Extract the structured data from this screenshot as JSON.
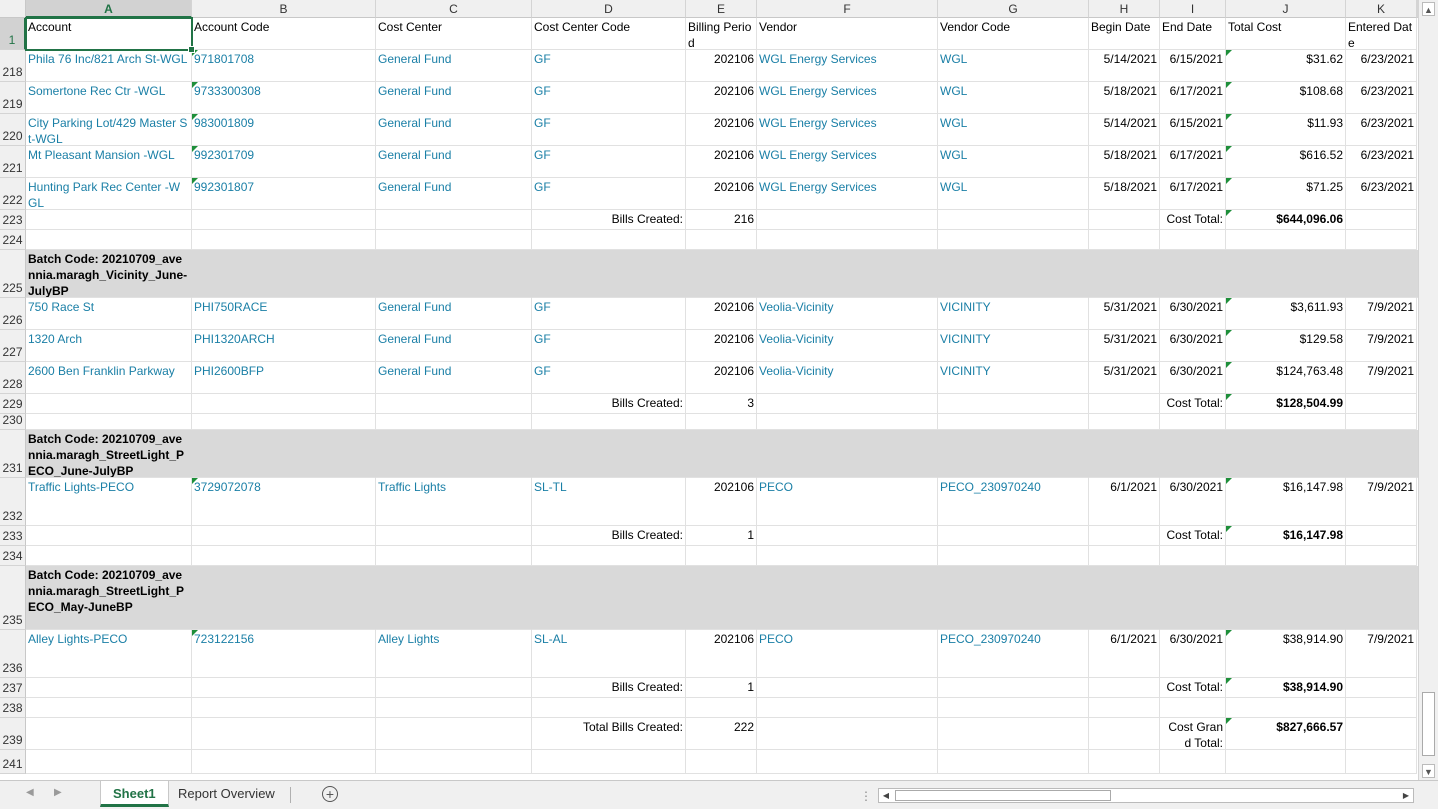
{
  "columns": [
    {
      "letter": "A",
      "w": 166,
      "selected": true
    },
    {
      "letter": "B",
      "w": 184
    },
    {
      "letter": "C",
      "w": 156
    },
    {
      "letter": "D",
      "w": 154
    },
    {
      "letter": "E",
      "w": 71
    },
    {
      "letter": "F",
      "w": 181
    },
    {
      "letter": "G",
      "w": 151
    },
    {
      "letter": "H",
      "w": 71
    },
    {
      "letter": "I",
      "w": 66
    },
    {
      "letter": "J",
      "w": 120
    },
    {
      "letter": "K",
      "w": 71
    }
  ],
  "rows": [
    {
      "num": "1",
      "h": 32,
      "selected": true,
      "cells": [
        {
          "c": 0,
          "t": "Account"
        },
        {
          "c": 1,
          "t": "Account Code"
        },
        {
          "c": 2,
          "t": "Cost Center"
        },
        {
          "c": 3,
          "t": "Cost Center Code"
        },
        {
          "c": 4,
          "t": "Billing Period",
          "wrap": true
        },
        {
          "c": 5,
          "t": "Vendor"
        },
        {
          "c": 6,
          "t": "Vendor Code"
        },
        {
          "c": 7,
          "t": "Begin Date"
        },
        {
          "c": 8,
          "t": "End Date"
        },
        {
          "c": 9,
          "t": "Total Cost"
        },
        {
          "c": 10,
          "t": "Entered Date",
          "wrap": true
        }
      ]
    },
    {
      "num": "218",
      "h": 32,
      "cells": [
        {
          "c": 0,
          "t": "Phila 76 Inc/821 Arch St-WGL",
          "cls": "teal"
        },
        {
          "c": 1,
          "t": "971801708",
          "cls": "teal flag"
        },
        {
          "c": 2,
          "t": "General Fund",
          "cls": "teal"
        },
        {
          "c": 3,
          "t": "GF",
          "cls": "teal"
        },
        {
          "c": 4,
          "t": "202106",
          "cls": "r"
        },
        {
          "c": 5,
          "t": "WGL Energy Services",
          "cls": "teal"
        },
        {
          "c": 6,
          "t": "WGL",
          "cls": "teal"
        },
        {
          "c": 7,
          "t": "5/14/2021",
          "cls": "r"
        },
        {
          "c": 8,
          "t": "6/15/2021",
          "cls": "r"
        },
        {
          "c": 9,
          "t": "$31.62",
          "cls": "r flag"
        },
        {
          "c": 10,
          "t": "6/23/2021",
          "cls": "r"
        }
      ]
    },
    {
      "num": "219",
      "h": 32,
      "cells": [
        {
          "c": 0,
          "t": "Somertone Rec Ctr -WGL",
          "cls": "teal"
        },
        {
          "c": 1,
          "t": "9733300308",
          "cls": "teal flag"
        },
        {
          "c": 2,
          "t": "General Fund",
          "cls": "teal"
        },
        {
          "c": 3,
          "t": "GF",
          "cls": "teal"
        },
        {
          "c": 4,
          "t": "202106",
          "cls": "r"
        },
        {
          "c": 5,
          "t": "WGL Energy Services",
          "cls": "teal"
        },
        {
          "c": 6,
          "t": "WGL",
          "cls": "teal"
        },
        {
          "c": 7,
          "t": "5/18/2021",
          "cls": "r"
        },
        {
          "c": 8,
          "t": "6/17/2021",
          "cls": "r"
        },
        {
          "c": 9,
          "t": "$108.68",
          "cls": "r flag"
        },
        {
          "c": 10,
          "t": "6/23/2021",
          "cls": "r"
        }
      ]
    },
    {
      "num": "220",
      "h": 32,
      "cells": [
        {
          "c": 0,
          "t": "City Parking Lot/429 Master St-WGL",
          "cls": "teal",
          "wrap": true
        },
        {
          "c": 1,
          "t": "983001809",
          "cls": "teal flag"
        },
        {
          "c": 2,
          "t": "General Fund",
          "cls": "teal"
        },
        {
          "c": 3,
          "t": "GF",
          "cls": "teal"
        },
        {
          "c": 4,
          "t": "202106",
          "cls": "r"
        },
        {
          "c": 5,
          "t": "WGL Energy Services",
          "cls": "teal"
        },
        {
          "c": 6,
          "t": "WGL",
          "cls": "teal"
        },
        {
          "c": 7,
          "t": "5/14/2021",
          "cls": "r"
        },
        {
          "c": 8,
          "t": "6/15/2021",
          "cls": "r"
        },
        {
          "c": 9,
          "t": "$11.93",
          "cls": "r flag"
        },
        {
          "c": 10,
          "t": "6/23/2021",
          "cls": "r"
        }
      ]
    },
    {
      "num": "221",
      "h": 32,
      "cells": [
        {
          "c": 0,
          "t": "Mt Pleasant Mansion -WGL",
          "cls": "teal"
        },
        {
          "c": 1,
          "t": "992301709",
          "cls": "teal flag"
        },
        {
          "c": 2,
          "t": "General Fund",
          "cls": "teal"
        },
        {
          "c": 3,
          "t": "GF",
          "cls": "teal"
        },
        {
          "c": 4,
          "t": "202106",
          "cls": "r"
        },
        {
          "c": 5,
          "t": "WGL Energy Services",
          "cls": "teal"
        },
        {
          "c": 6,
          "t": "WGL",
          "cls": "teal"
        },
        {
          "c": 7,
          "t": "5/18/2021",
          "cls": "r"
        },
        {
          "c": 8,
          "t": "6/17/2021",
          "cls": "r"
        },
        {
          "c": 9,
          "t": "$616.52",
          "cls": "r flag"
        },
        {
          "c": 10,
          "t": "6/23/2021",
          "cls": "r"
        }
      ]
    },
    {
      "num": "222",
      "h": 32,
      "cells": [
        {
          "c": 0,
          "t": "Hunting Park Rec Center -WGL",
          "cls": "teal",
          "wrap": true
        },
        {
          "c": 1,
          "t": "992301807",
          "cls": "teal flag"
        },
        {
          "c": 2,
          "t": "General Fund",
          "cls": "teal"
        },
        {
          "c": 3,
          "t": "GF",
          "cls": "teal"
        },
        {
          "c": 4,
          "t": "202106",
          "cls": "r"
        },
        {
          "c": 5,
          "t": "WGL Energy Services",
          "cls": "teal"
        },
        {
          "c": 6,
          "t": "WGL",
          "cls": "teal"
        },
        {
          "c": 7,
          "t": "5/18/2021",
          "cls": "r"
        },
        {
          "c": 8,
          "t": "6/17/2021",
          "cls": "r"
        },
        {
          "c": 9,
          "t": "$71.25",
          "cls": "r flag"
        },
        {
          "c": 10,
          "t": "6/23/2021",
          "cls": "r"
        }
      ]
    },
    {
      "num": "223",
      "h": 20,
      "cells": [
        {
          "c": 3,
          "t": "Bills Created:",
          "cls": "r"
        },
        {
          "c": 4,
          "t": "216",
          "cls": "r"
        },
        {
          "c": 8,
          "t": "Cost Total:",
          "cls": "r"
        },
        {
          "c": 9,
          "t": "$644,096.06",
          "cls": "r flag bold"
        }
      ]
    },
    {
      "num": "224",
      "h": 20,
      "cells": []
    },
    {
      "num": "225",
      "h": 48,
      "grey": true,
      "cells": [
        {
          "c": 0,
          "t": "Batch Code: 20210709_avennia.maragh_Vicinity_June-JulyBP",
          "cls": "bold",
          "wrap": true
        }
      ]
    },
    {
      "num": "226",
      "h": 32,
      "cells": [
        {
          "c": 0,
          "t": "750 Race St",
          "cls": "teal"
        },
        {
          "c": 1,
          "t": "PHI750RACE",
          "cls": "teal"
        },
        {
          "c": 2,
          "t": "General Fund",
          "cls": "teal"
        },
        {
          "c": 3,
          "t": "GF",
          "cls": "teal"
        },
        {
          "c": 4,
          "t": "202106",
          "cls": "r"
        },
        {
          "c": 5,
          "t": "Veolia-Vicinity",
          "cls": "teal"
        },
        {
          "c": 6,
          "t": "VICINITY",
          "cls": "teal"
        },
        {
          "c": 7,
          "t": "5/31/2021",
          "cls": "r"
        },
        {
          "c": 8,
          "t": "6/30/2021",
          "cls": "r"
        },
        {
          "c": 9,
          "t": "$3,611.93",
          "cls": "r flag"
        },
        {
          "c": 10,
          "t": "7/9/2021",
          "cls": "r"
        }
      ]
    },
    {
      "num": "227",
      "h": 32,
      "cells": [
        {
          "c": 0,
          "t": "1320 Arch",
          "cls": "teal"
        },
        {
          "c": 1,
          "t": "PHI1320ARCH",
          "cls": "teal"
        },
        {
          "c": 2,
          "t": "General Fund",
          "cls": "teal"
        },
        {
          "c": 3,
          "t": "GF",
          "cls": "teal"
        },
        {
          "c": 4,
          "t": "202106",
          "cls": "r"
        },
        {
          "c": 5,
          "t": "Veolia-Vicinity",
          "cls": "teal"
        },
        {
          "c": 6,
          "t": "VICINITY",
          "cls": "teal"
        },
        {
          "c": 7,
          "t": "5/31/2021",
          "cls": "r"
        },
        {
          "c": 8,
          "t": "6/30/2021",
          "cls": "r"
        },
        {
          "c": 9,
          "t": "$129.58",
          "cls": "r flag"
        },
        {
          "c": 10,
          "t": "7/9/2021",
          "cls": "r"
        }
      ]
    },
    {
      "num": "228",
      "h": 32,
      "cells": [
        {
          "c": 0,
          "t": "2600 Ben Franklin Parkway",
          "cls": "teal"
        },
        {
          "c": 1,
          "t": "PHI2600BFP",
          "cls": "teal"
        },
        {
          "c": 2,
          "t": "General Fund",
          "cls": "teal"
        },
        {
          "c": 3,
          "t": "GF",
          "cls": "teal"
        },
        {
          "c": 4,
          "t": "202106",
          "cls": "r"
        },
        {
          "c": 5,
          "t": "Veolia-Vicinity",
          "cls": "teal"
        },
        {
          "c": 6,
          "t": "VICINITY",
          "cls": "teal"
        },
        {
          "c": 7,
          "t": "5/31/2021",
          "cls": "r"
        },
        {
          "c": 8,
          "t": "6/30/2021",
          "cls": "r"
        },
        {
          "c": 9,
          "t": "$124,763.48",
          "cls": "r flag"
        },
        {
          "c": 10,
          "t": "7/9/2021",
          "cls": "r"
        }
      ]
    },
    {
      "num": "229",
      "h": 20,
      "cells": [
        {
          "c": 3,
          "t": "Bills Created:",
          "cls": "r"
        },
        {
          "c": 4,
          "t": "3",
          "cls": "r"
        },
        {
          "c": 8,
          "t": "Cost Total:",
          "cls": "r"
        },
        {
          "c": 9,
          "t": "$128,504.99",
          "cls": "r flag bold"
        }
      ]
    },
    {
      "num": "230",
      "h": 16,
      "cells": []
    },
    {
      "num": "231",
      "h": 48,
      "grey": true,
      "cells": [
        {
          "c": 0,
          "t": "Batch Code: 20210709_avennia.maragh_StreetLight_PECO_June-JulyBP",
          "cls": "bold",
          "wrap": true
        }
      ]
    },
    {
      "num": "232",
      "h": 48,
      "cells": [
        {
          "c": 0,
          "t": "Traffic Lights-PECO",
          "cls": "teal"
        },
        {
          "c": 1,
          "t": "3729072078",
          "cls": "teal flag"
        },
        {
          "c": 2,
          "t": "Traffic Lights",
          "cls": "teal"
        },
        {
          "c": 3,
          "t": "SL-TL",
          "cls": "teal"
        },
        {
          "c": 4,
          "t": "202106",
          "cls": "r"
        },
        {
          "c": 5,
          "t": "PECO",
          "cls": "teal"
        },
        {
          "c": 6,
          "t": "PECO_230970240",
          "cls": "teal"
        },
        {
          "c": 7,
          "t": "6/1/2021",
          "cls": "r"
        },
        {
          "c": 8,
          "t": "6/30/2021",
          "cls": "r"
        },
        {
          "c": 9,
          "t": "$16,147.98",
          "cls": "r flag"
        },
        {
          "c": 10,
          "t": "7/9/2021",
          "cls": "r"
        }
      ]
    },
    {
      "num": "233",
      "h": 20,
      "cells": [
        {
          "c": 3,
          "t": "Bills Created:",
          "cls": "r"
        },
        {
          "c": 4,
          "t": "1",
          "cls": "r"
        },
        {
          "c": 8,
          "t": "Cost Total:",
          "cls": "r"
        },
        {
          "c": 9,
          "t": "$16,147.98",
          "cls": "r flag bold"
        }
      ]
    },
    {
      "num": "234",
      "h": 20,
      "cells": []
    },
    {
      "num": "235",
      "h": 64,
      "grey": true,
      "cells": [
        {
          "c": 0,
          "t": "Batch Code: 20210709_avennia.maragh_StreetLight_PECO_May-JuneBP",
          "cls": "bold",
          "wrap": true
        }
      ]
    },
    {
      "num": "236",
      "h": 48,
      "cells": [
        {
          "c": 0,
          "t": "Alley Lights-PECO",
          "cls": "teal"
        },
        {
          "c": 1,
          "t": "723122156",
          "cls": "teal flag"
        },
        {
          "c": 2,
          "t": "Alley Lights",
          "cls": "teal"
        },
        {
          "c": 3,
          "t": "SL-AL",
          "cls": "teal"
        },
        {
          "c": 4,
          "t": "202106",
          "cls": "r"
        },
        {
          "c": 5,
          "t": "PECO",
          "cls": "teal"
        },
        {
          "c": 6,
          "t": "PECO_230970240",
          "cls": "teal"
        },
        {
          "c": 7,
          "t": "6/1/2021",
          "cls": "r"
        },
        {
          "c": 8,
          "t": "6/30/2021",
          "cls": "r"
        },
        {
          "c": 9,
          "t": "$38,914.90",
          "cls": "r flag"
        },
        {
          "c": 10,
          "t": "7/9/2021",
          "cls": "r"
        }
      ]
    },
    {
      "num": "237",
      "h": 20,
      "cells": [
        {
          "c": 3,
          "t": "Bills Created:",
          "cls": "r"
        },
        {
          "c": 4,
          "t": "1",
          "cls": "r"
        },
        {
          "c": 8,
          "t": "Cost Total:",
          "cls": "r"
        },
        {
          "c": 9,
          "t": "$38,914.90",
          "cls": "r flag bold"
        }
      ]
    },
    {
      "num": "238",
      "h": 20,
      "cells": []
    },
    {
      "num": "239",
      "h": 32,
      "cells": [
        {
          "c": 3,
          "t": "Total Bills Created:",
          "cls": "r"
        },
        {
          "c": 4,
          "t": "222",
          "cls": "r"
        },
        {
          "c": 8,
          "t": "Cost Grand Total:",
          "cls": "r",
          "wrap": true
        },
        {
          "c": 9,
          "t": "$827,666.57",
          "cls": "r flag bold"
        }
      ]
    },
    {
      "num": "241",
      "h": 24,
      "cells": []
    }
  ],
  "tabs": {
    "sheet1": "Sheet1",
    "report_overview": "Report Overview",
    "add_sheet": "+"
  },
  "icons": {
    "nav_prev": "◀",
    "nav_next": "▶",
    "scroll_up": "▲",
    "scroll_down": "▼",
    "scroll_left": "◀",
    "scroll_right": "▶",
    "splitter": "⋮"
  },
  "colors": {
    "accent": "#217346",
    "link_teal": "#1a7fa6",
    "batch_grey": "#d9d9d9",
    "flag_green": "#1e8f3a"
  }
}
